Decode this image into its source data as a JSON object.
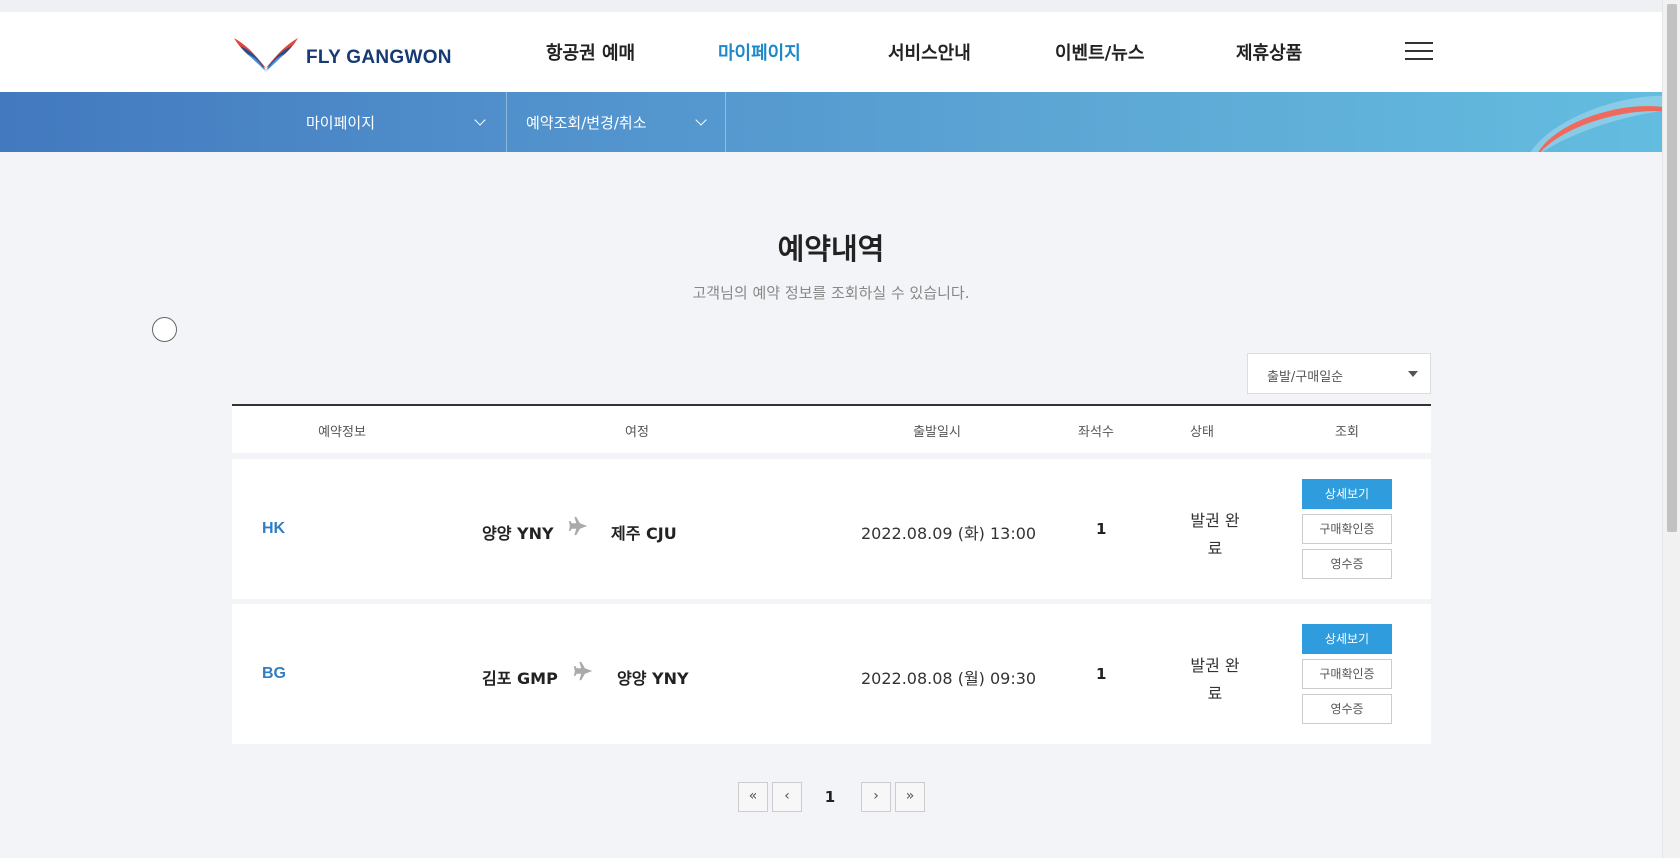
{
  "header": {
    "logo_text": "FLY GANGWON",
    "nav": [
      {
        "label": "항공권 예매",
        "active": false
      },
      {
        "label": "마이페이지",
        "active": true
      },
      {
        "label": "서비스안내",
        "active": false
      },
      {
        "label": "이벤트/뉴스",
        "active": false
      },
      {
        "label": "제휴상품",
        "active": false
      }
    ],
    "menu_icon": "hamburger-icon"
  },
  "subnav": {
    "dropdown1": "마이페이지",
    "dropdown2": "예약조회/변경/취소"
  },
  "main": {
    "title": "예약내역",
    "description": "고객님의 예약 정보를 조회하실 수 있습니다.",
    "sort": {
      "selected": "출발/구매일순"
    },
    "columns": [
      "예약정보",
      "여정",
      "출발일시",
      "좌석수",
      "상태",
      "조회"
    ],
    "rows": [
      {
        "code": "HK",
        "departure": "양양 YNY",
        "arrival": "제주 CJU",
        "datetime": "2022.08.09 (화) 13:00",
        "seats": "1",
        "status_line1": "발권 완",
        "status_line2": "료",
        "btn_detail": "상세보기",
        "btn_confirm": "구매확인증",
        "btn_receipt": "영수증"
      },
      {
        "code": "BG",
        "departure": "김포 GMP",
        "arrival": "양양 YNY",
        "datetime": "2022.08.08 (월) 09:30",
        "seats": "1",
        "status_line1": "발권 완",
        "status_line2": "료",
        "btn_detail": "상세보기",
        "btn_confirm": "구매확인증",
        "btn_receipt": "영수증"
      }
    ]
  },
  "pagination": {
    "first": "«",
    "prev": "‹",
    "current": "1",
    "next": "›",
    "last": "»"
  },
  "colors": {
    "accent": "#1e88c8",
    "primary_button": "#2f9ddd",
    "code_text": "#2f7ec4",
    "subnav_start": "#4379bf",
    "subnav_end": "#63bde0",
    "logo_red": "#e2463b",
    "logo_blue": "#1f4f8f"
  }
}
